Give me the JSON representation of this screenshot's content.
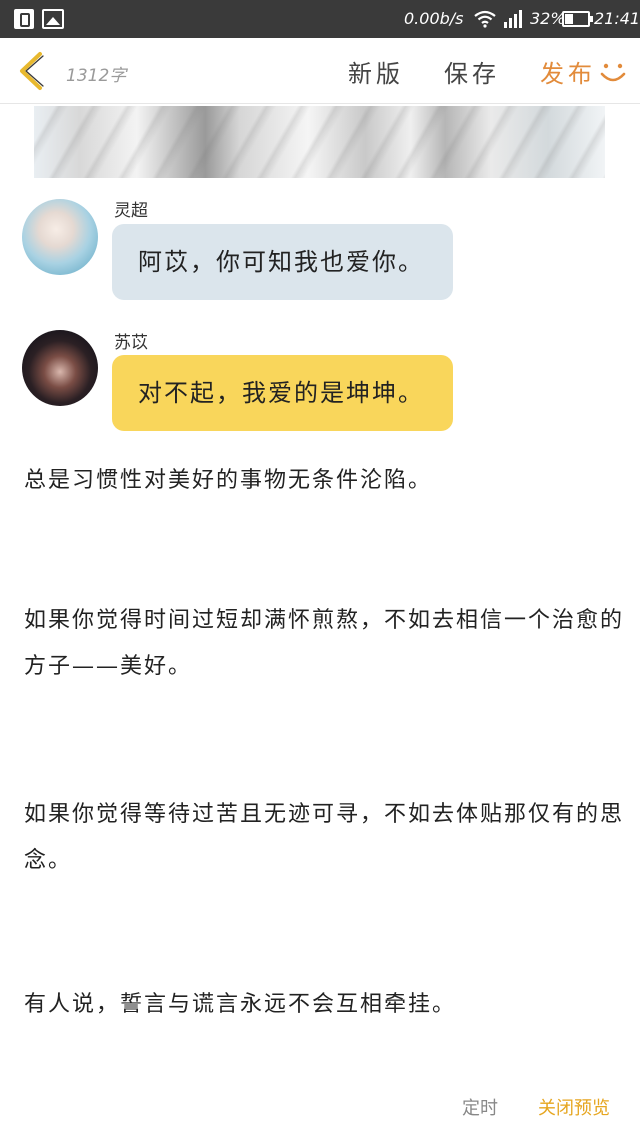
{
  "status_bar": {
    "net_speed": "0.00b/s",
    "battery_percent": "32%",
    "time": "21:41",
    "icons": [
      "sim-card-icon",
      "gallery-icon",
      "wifi-icon",
      "signal-icon",
      "battery-icon"
    ]
  },
  "toolbar": {
    "word_count": "1312字",
    "new_version_label": "新版",
    "save_label": "保存",
    "publish_label": "发布",
    "accent_color": "#e28b3b"
  },
  "chat": [
    {
      "speaker": "灵超",
      "message": "阿苡，你可知我也爱你。",
      "bubble_color": "#dbe5ec"
    },
    {
      "speaker": "苏苡",
      "message": "对不起，我爱的是坤坤。",
      "bubble_color": "#f9d65b"
    }
  ],
  "paragraphs": [
    "总是习惯性对美好的事物无条件沦陷。",
    "如果你觉得时间过短却满怀煎熬，不如去相信一个治愈的方子——美好。",
    "如果你觉得等待过苦且无迹可寻，不如去体贴那仅有的思念。",
    "有人说，誓言与谎言永远不会互相牵挂。"
  ],
  "bottom_bar": {
    "timer_label": "定时",
    "close_preview_label": "关闭预览",
    "close_preview_color": "#e6a620"
  }
}
